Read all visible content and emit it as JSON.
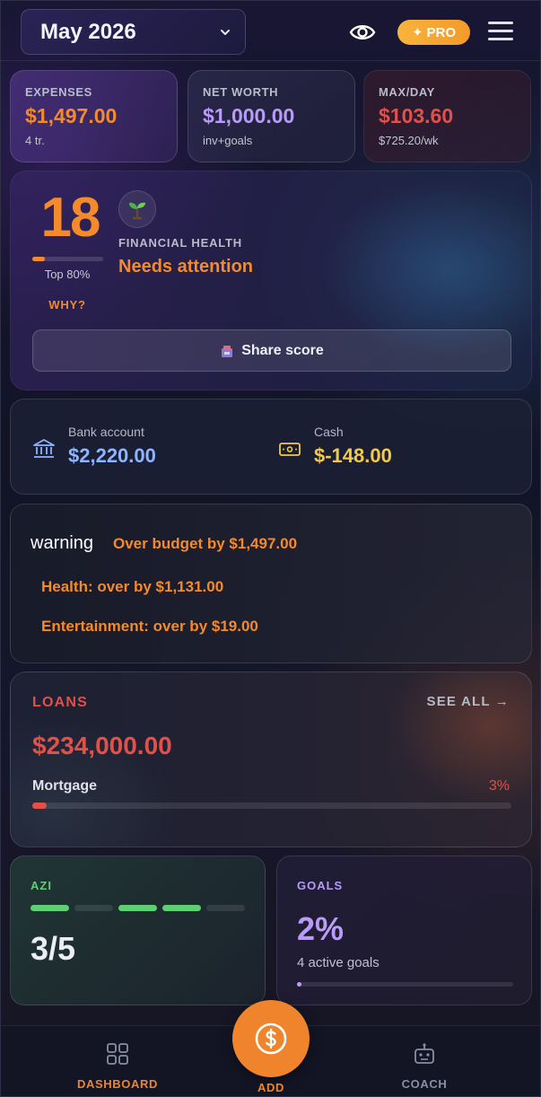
{
  "header": {
    "month": "May 2026",
    "pro_label": "PRO",
    "pro_glyph": "✦"
  },
  "stats": [
    {
      "label": "EXPENSES",
      "value": "$1,497.00",
      "sub": "4 tr.",
      "color": "#f48a2a"
    },
    {
      "label": "NET WORTH",
      "value": "$1,000.00",
      "sub": "inv+goals",
      "color": "#b89cf8"
    },
    {
      "label": "MAX/DAY",
      "value": "$103.60",
      "sub": "$725.20/wk",
      "color": "#e2504a"
    }
  ],
  "health": {
    "score": "18",
    "score_fraction": 0.18,
    "rank": "Top 80%",
    "why": "WHY?",
    "label": "FINANCIAL HEALTH",
    "status": "Needs attention",
    "share_label": "Share score"
  },
  "accounts": [
    {
      "label": "Bank account",
      "value": "$2,220.00",
      "color": "#8fb4ff",
      "icon": "bank-icon"
    },
    {
      "label": "Cash",
      "value": "$-148.00",
      "color": "#f2c94c",
      "icon": "cash-icon"
    }
  ],
  "warning": {
    "icon_text": "warning",
    "title": "Over budget by $1,497.00",
    "items": [
      "Health: over by $1,131.00",
      "Entertainment: over by $19.00"
    ]
  },
  "loans": {
    "title": "LOANS",
    "see_all": "SEE ALL →",
    "total": "$234,000.00",
    "items": [
      {
        "name": "Mortgage",
        "percent": "3%",
        "fraction": 0.03
      }
    ]
  },
  "azi": {
    "title": "AZI",
    "value": "3/5",
    "segments": [
      true,
      false,
      true,
      true,
      false
    ]
  },
  "goals": {
    "title": "GOALS",
    "value": "2%",
    "sub": "4 active goals",
    "fraction": 0.02
  },
  "nav": {
    "dashboard": "DASHBOARD",
    "add": "ADD",
    "coach": "COACH",
    "active_color": "#f0842c",
    "inactive_color": "#8a8ea0"
  }
}
